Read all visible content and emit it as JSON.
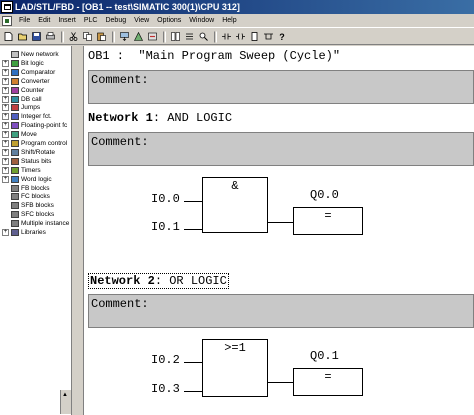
{
  "window": {
    "title": "LAD/STL/FBD  - [OB1 -- test\\SIMATIC 300(1)\\CPU 312]"
  },
  "menu": {
    "items": [
      "File",
      "Edit",
      "Insert",
      "PLC",
      "Debug",
      "View",
      "Options",
      "Window",
      "Help"
    ]
  },
  "toolbar": {
    "icons": [
      "new-icon",
      "open-icon",
      "save-icon",
      "print-icon",
      "cut-icon",
      "copy-icon",
      "paste-icon",
      "download-icon",
      "monitor-icon",
      "online-icon",
      "overview-icon",
      "detail-icon",
      "zoom-icon",
      "contact-icon",
      "coil-icon",
      "box-icon",
      "branch-icon",
      "help-icon"
    ],
    "help_label": "?"
  },
  "tree": {
    "items": [
      {
        "label": "New network",
        "expander": ""
      },
      {
        "label": "Bit logic",
        "expander": "+"
      },
      {
        "label": "Comparator",
        "expander": "+"
      },
      {
        "label": "Converter",
        "expander": "+"
      },
      {
        "label": "Counter",
        "expander": "+"
      },
      {
        "label": "DB call",
        "expander": "+"
      },
      {
        "label": "Jumps",
        "expander": "+"
      },
      {
        "label": "Integer fct.",
        "expander": "+"
      },
      {
        "label": "Floating-point fc",
        "expander": "+"
      },
      {
        "label": "Move",
        "expander": "+"
      },
      {
        "label": "Program control",
        "expander": "+"
      },
      {
        "label": "Shift/Rotate",
        "expander": "+"
      },
      {
        "label": "Status bits",
        "expander": "+"
      },
      {
        "label": "Timers",
        "expander": "+"
      },
      {
        "label": "Word logic",
        "expander": "+"
      },
      {
        "label": "FB blocks",
        "expander": ""
      },
      {
        "label": "FC blocks",
        "expander": ""
      },
      {
        "label": "SFB blocks",
        "expander": ""
      },
      {
        "label": "SFC blocks",
        "expander": ""
      },
      {
        "label": "Multiple instance",
        "expander": ""
      },
      {
        "label": "Libraries",
        "expander": "+"
      }
    ]
  },
  "editor": {
    "block_title": "OB1 :  \"Main Program Sweep (Cycle)\"",
    "comment_label": "Comment:",
    "networks": [
      {
        "label": "Network 1",
        "title": ": AND LOGIC",
        "comment": "Comment:",
        "block": "&",
        "inputs": [
          "I0.0",
          "I0.1"
        ],
        "output": "Q0.0",
        "coil": "="
      },
      {
        "label": "Network 2",
        "title": ": OR LOGIC",
        "comment": "Comment:",
        "block": ">=1",
        "inputs": [
          "I0.2",
          "I0.3"
        ],
        "output": "Q0.1",
        "coil": "="
      }
    ]
  },
  "colors": {
    "title_bar": "#0a246a",
    "comment_bg": "#c8c8c8",
    "tree_bg": "#ffffff"
  }
}
